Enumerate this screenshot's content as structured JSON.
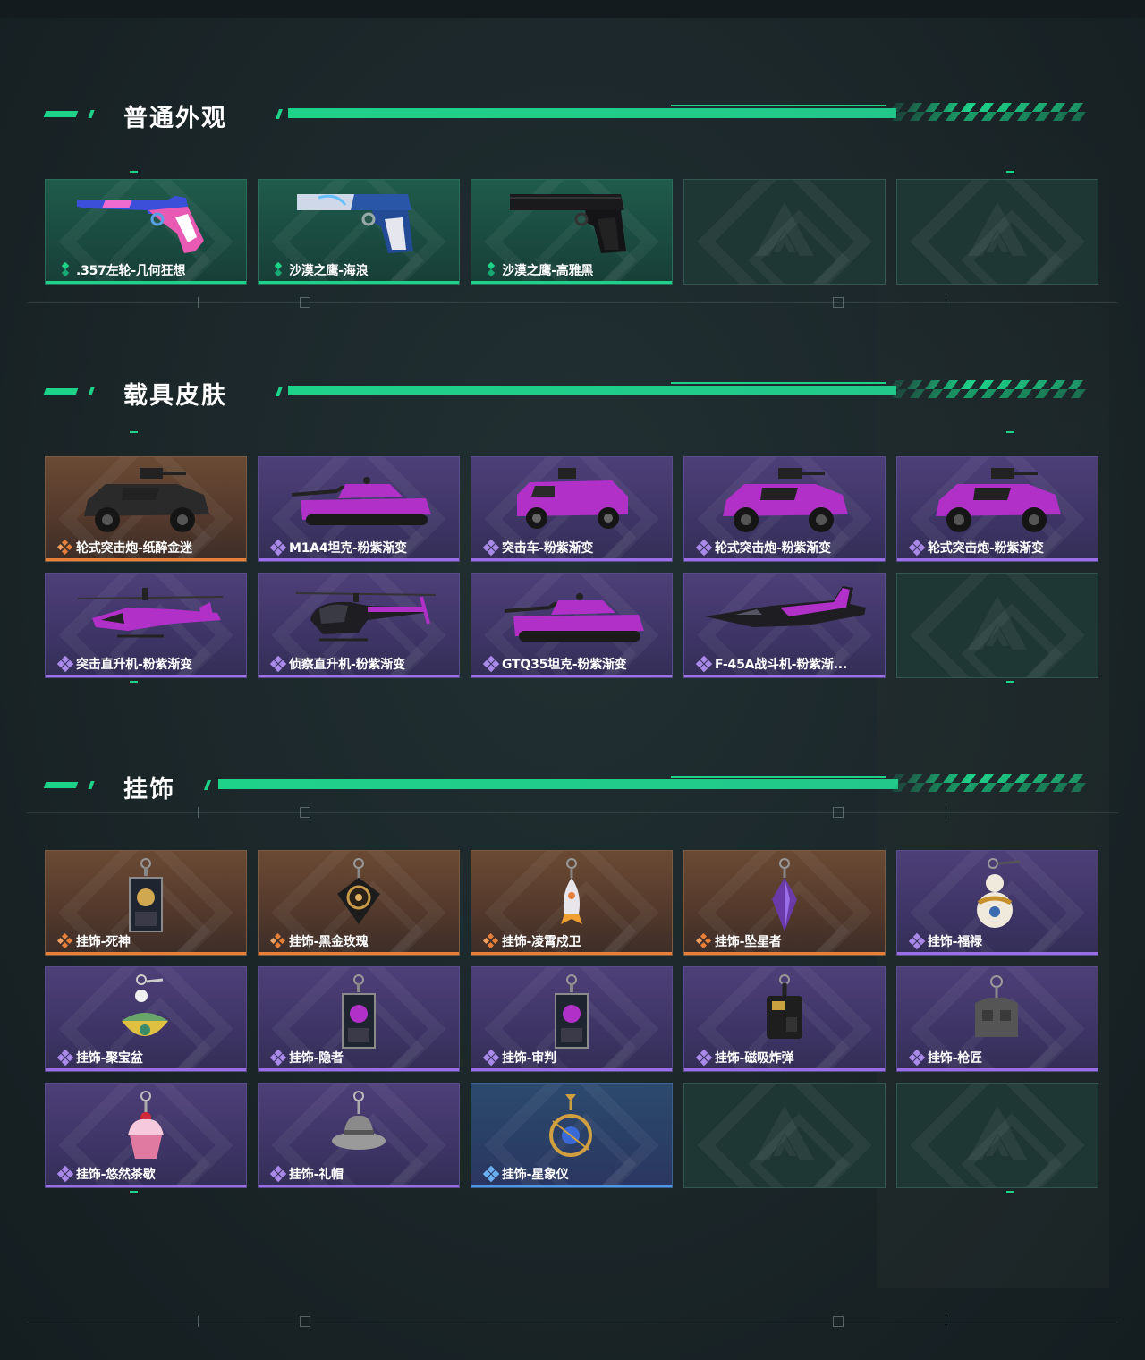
{
  "sections": [
    {
      "title": "普通外观",
      "items": [
        {
          "label": ".357左轮-几何狂想",
          "rarity": "green",
          "icon": "revolver-icon"
        },
        {
          "label": "沙漠之鹰-海浪",
          "rarity": "green",
          "icon": "pistol-icon"
        },
        {
          "label": "沙漠之鹰-高雅黑",
          "rarity": "green",
          "icon": "pistol-icon"
        },
        {
          "label": "",
          "rarity": "empty",
          "icon": "empty-slot-logo-icon"
        },
        {
          "label": "",
          "rarity": "empty",
          "icon": "empty-slot-logo-icon"
        }
      ]
    },
    {
      "title": "载具皮肤",
      "items": [
        {
          "label": "轮式突击炮-纸醉金迷",
          "rarity": "gold",
          "icon": "armored-vehicle-icon"
        },
        {
          "label": "M1A4坦克-粉紫渐变",
          "rarity": "purple",
          "icon": "tank-icon"
        },
        {
          "label": "突击车-粉紫渐变",
          "rarity": "purple",
          "icon": "assault-car-icon"
        },
        {
          "label": "轮式突击炮-粉紫渐变",
          "rarity": "purple",
          "icon": "armored-vehicle-icon"
        },
        {
          "label": "轮式突击炮-粉紫渐变",
          "rarity": "purple",
          "icon": "armored-vehicle-icon"
        },
        {
          "label": "突击直升机-粉紫渐变",
          "rarity": "purple",
          "icon": "attack-helicopter-icon"
        },
        {
          "label": "侦察直升机-粉紫渐变",
          "rarity": "purple",
          "icon": "scout-helicopter-icon"
        },
        {
          "label": "GTQ35坦克-粉紫渐变",
          "rarity": "purple",
          "icon": "tank-icon"
        },
        {
          "label": "F-45A战斗机-粉紫渐...",
          "rarity": "purple",
          "icon": "fighter-jet-icon"
        },
        {
          "label": "",
          "rarity": "empty",
          "icon": "empty-slot-logo-icon"
        }
      ]
    },
    {
      "title": "挂饰",
      "items": [
        {
          "label": "挂饰-死神",
          "rarity": "gold",
          "icon": "charm-card-icon"
        },
        {
          "label": "挂饰-黑金玫瑰",
          "rarity": "gold",
          "icon": "charm-rose-icon"
        },
        {
          "label": "挂饰-凌霄戍卫",
          "rarity": "gold",
          "icon": "charm-rocket-icon"
        },
        {
          "label": "挂饰-坠星者",
          "rarity": "gold",
          "icon": "charm-crystal-icon"
        },
        {
          "label": "挂饰-福禄",
          "rarity": "purple",
          "icon": "charm-gourd-icon"
        },
        {
          "label": "挂饰-聚宝盆",
          "rarity": "purple",
          "icon": "charm-bowl-icon"
        },
        {
          "label": "挂饰-隐者",
          "rarity": "purple",
          "icon": "charm-card-icon"
        },
        {
          "label": "挂饰-审判",
          "rarity": "purple",
          "icon": "charm-card-icon"
        },
        {
          "label": "挂饰-磁吸炸弹",
          "rarity": "purple",
          "icon": "charm-bomb-icon"
        },
        {
          "label": "挂饰-枪匠",
          "rarity": "purple",
          "icon": "charm-vest-icon"
        },
        {
          "label": "挂饰-悠然茶歇",
          "rarity": "purple",
          "icon": "charm-cupcake-icon"
        },
        {
          "label": "挂饰-礼帽",
          "rarity": "purple",
          "icon": "charm-hat-icon"
        },
        {
          "label": "挂饰-星象仪",
          "rarity": "blue",
          "icon": "charm-astrolabe-icon"
        },
        {
          "label": "",
          "rarity": "empty",
          "icon": "empty-slot-logo-icon"
        },
        {
          "label": "",
          "rarity": "empty",
          "icon": "empty-slot-logo-icon"
        }
      ]
    }
  ],
  "colors": {
    "accent": "#1fd28a",
    "rarity_green": "#1fd28a",
    "rarity_gold": "#e8803a",
    "rarity_purple": "#9a6ee6",
    "rarity_blue": "#4a9ae6"
  }
}
